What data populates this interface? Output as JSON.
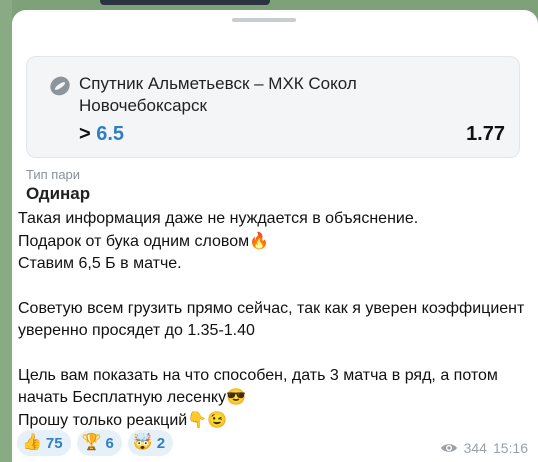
{
  "card": {
    "match": "Спутник Альметьевск – МХК Сокол Новочебоксарск",
    "bet_prefix": ">",
    "bet_value": "6.5",
    "odds": "1.77"
  },
  "bet_type": {
    "label": "Тип пари",
    "value": "Одинар"
  },
  "message": {
    "lines_block1": [
      "Такая информация даже не нуждается в объяснение.",
      "Подарок от бука одним словом🔥",
      "Ставим 6,5 Б в матче."
    ],
    "lines_block2": [
      "Советую всем грузить прямо сейчас, так как я уверен коэффициент уверенно просядет до 1.35-1.40"
    ],
    "lines_block3": [
      "Цель вам показать на что способен, дать 3 матча в ряд, а потом начать Бесплатную лесенку😎",
      "Прошу только реакций👇😉"
    ]
  },
  "reactions": [
    {
      "emoji": "👍",
      "count": "75",
      "icon": "thumbs-up-icon"
    },
    {
      "emoji": "🏆",
      "count": "6",
      "icon": "trophy-icon"
    },
    {
      "emoji": "🤯",
      "count": "2",
      "icon": "exploding-head-icon"
    }
  ],
  "meta": {
    "views": "344",
    "time": "15:16"
  },
  "colors": {
    "accent": "#2f7fc1",
    "chat_background": "#7fa17a"
  }
}
